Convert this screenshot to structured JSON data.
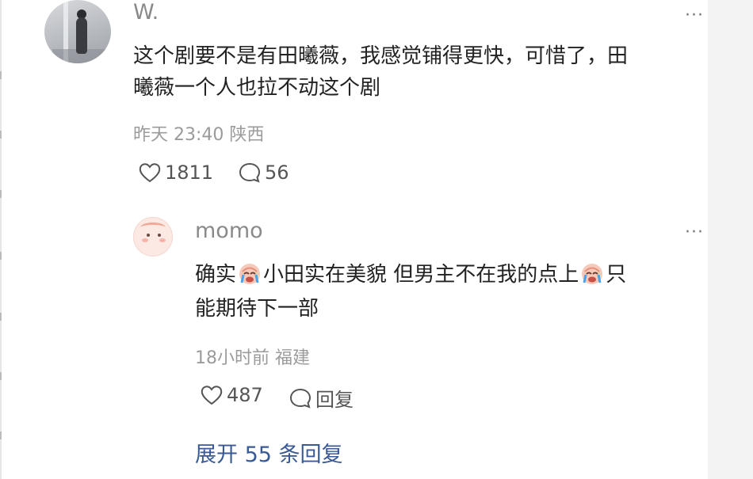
{
  "comment": {
    "username": "W.",
    "text_line1": "这个剧要不是有田曦薇，我感觉铺得更快，可惜了，田",
    "text_line2": "曦薇一个人也拉不动这个剧",
    "time": "昨天 23:40",
    "location": "陕西",
    "likes": "1811",
    "replies": "56"
  },
  "reply": {
    "username": "momo",
    "seg1": "确实",
    "seg2": "小田实在美貌 但男主不在我的点上",
    "seg3": "只",
    "text_line2": "能期待下一部",
    "time": "18小时前",
    "location": "福建",
    "likes": "487",
    "reply_label": "回复"
  },
  "expand_label": "展开 55 条回复",
  "more_label": "···",
  "icons": {
    "like": "heart-outline-icon",
    "comment": "comment-bubble-icon",
    "emoji": "crying-face-emoji"
  },
  "colors": {
    "link": "#3a5a95",
    "meta": "#9b9b9b",
    "username": "#8a8a8a"
  }
}
